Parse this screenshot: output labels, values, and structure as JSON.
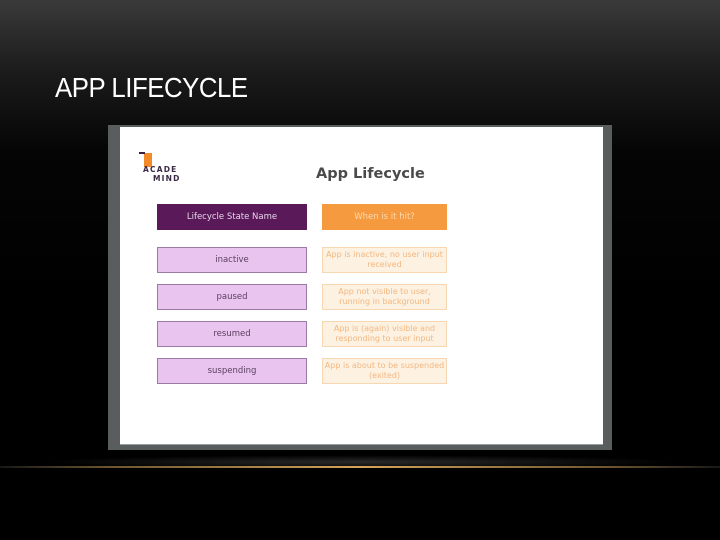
{
  "slide": {
    "title": "APP LIFECYCLE"
  },
  "screenshot": {
    "logo": {
      "line1": "ACADE",
      "line2": "MIND",
      "accent_color": "#f28a2a"
    },
    "title": "App Lifecycle",
    "headers": {
      "state": "Lifecycle State Name",
      "when": "When is it hit?"
    },
    "rows": [
      {
        "state": "inactive",
        "when": "App is inactive, no user input received"
      },
      {
        "state": "paused",
        "when": "App not visible to user, running in background"
      },
      {
        "state": "resumed",
        "when": "App is (again) visible and responding to user input"
      },
      {
        "state": "suspending",
        "when": "App is about to be suspended (exited)"
      }
    ],
    "colors": {
      "header_state_bg": "#5a1a5a",
      "header_when_bg": "#f59a3e",
      "state_bg": "#e9c4ee",
      "when_bg": "#fdf1e2"
    }
  }
}
